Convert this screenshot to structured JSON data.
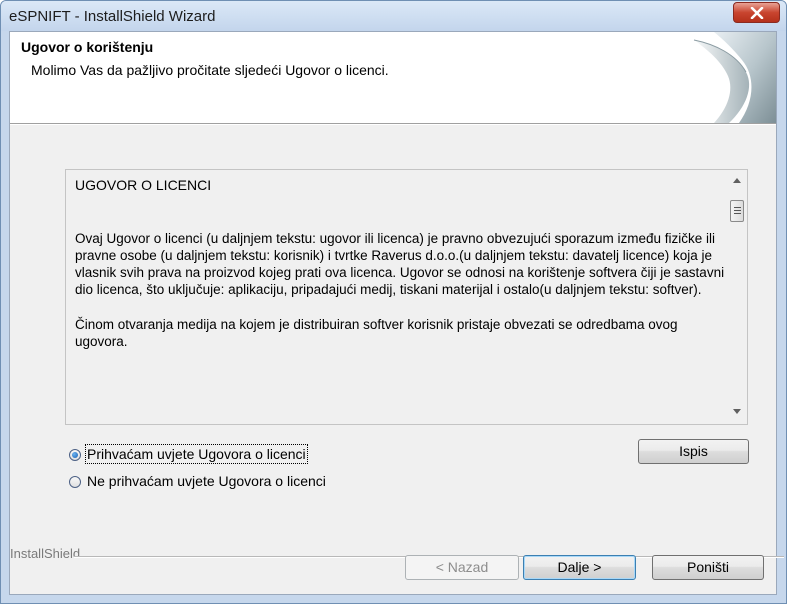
{
  "window": {
    "title": "eSPNIFT - InstallShield Wizard"
  },
  "header": {
    "title": "Ugovor o korištenju",
    "subtitle": "Molimo Vas da pažljivo pročitate sljedeći Ugovor o licenci."
  },
  "license": {
    "heading": "UGOVOR O LICENCI",
    "paragraph1": "Ovaj Ugovor o licenci (u daljnjem tekstu: ugovor ili licenca) je pravno obvezujući sporazum između fizičke ili pravne osobe (u daljnjem tekstu: korisnik) i tvrtke Raverus d.o.o.(u daljnjem tekstu: davatelj licence) koja je vlasnik svih prava na proizvod kojeg prati ova licenca. Ugovor se odnosi na korištenje softvera čiji je sastavni dio licenca, što uključuje: aplikaciju, pripadajući medij, tiskani materijal i ostalo(u daljnjem tekstu: softver).",
    "paragraph2": "Činom otvaranja medija na kojem je distribuiran softver korisnik pristaje obvezati se odredbama ovog ugovora."
  },
  "options": {
    "accept": "Prihvaćam uvjete Ugovora o licenci",
    "decline": "Ne prihvaćam uvjete Ugovora o licenci",
    "selected": "accept"
  },
  "buttons": {
    "print": "Ispis",
    "back": "< Nazad",
    "next": "Dalje >",
    "cancel": "Poništi"
  },
  "footer": {
    "brand": "InstallShield"
  },
  "colors": {
    "accent": "#3c7fb1",
    "close_red": "#c9452f",
    "title_bar": "#c6d7ec"
  },
  "icons": {
    "close": "close-icon",
    "header_graphic": "wizard-page-curl-graphic"
  }
}
